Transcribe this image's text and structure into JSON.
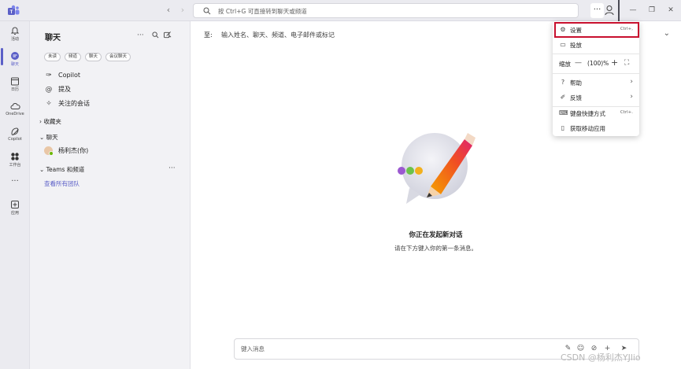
{
  "colors": {
    "accent": "#5b5fc7",
    "highlight": "#c8102e",
    "rail_bg": "#ebebf0",
    "list_bg": "#f2f2f5"
  },
  "search": {
    "placeholder": "按 Ctrl+G 可直接转到聊天或频道"
  },
  "rail": {
    "items": [
      {
        "label": "活动",
        "icon": "bell-icon"
      },
      {
        "label": "聊天",
        "icon": "chat-icon"
      },
      {
        "label": "日历",
        "icon": "calendar-icon"
      },
      {
        "label": "OneDrive",
        "icon": "cloud-icon"
      },
      {
        "label": "Copilot",
        "icon": "copilot-icon"
      },
      {
        "label": "工作台",
        "icon": "apps-grid-icon"
      },
      {
        "label": "",
        "icon": "more-icon"
      },
      {
        "label": "应用",
        "icon": "add-app-icon"
      }
    ]
  },
  "chatlist": {
    "title": "聊天",
    "filters": [
      "未读",
      "频道",
      "聊天",
      "会议聊天"
    ],
    "quick": [
      {
        "label": "Copilot",
        "icon": "copilot-icon"
      },
      {
        "label": "提及",
        "icon": "at-icon"
      },
      {
        "label": "关注的会话",
        "icon": "follow-icon"
      }
    ],
    "favorites": "收藏夹",
    "chats_section": "聊天",
    "chats": [
      {
        "name": "杨利杰(你)"
      }
    ],
    "teams_section": "Teams 和频道",
    "see_all_teams": "查看所有团队"
  },
  "main": {
    "to_label": "至:",
    "to_placeholder": "输入姓名、聊天、频道、电子邮件或标记",
    "empty_title": "你正在发起新对话",
    "empty_subtitle": "请在下方键入你的第一条消息。",
    "composer_placeholder": "键入消息"
  },
  "menu": {
    "settings": {
      "label": "设置",
      "shortcut": "Ctrl+,"
    },
    "cast": {
      "label": "投放"
    },
    "zoom": {
      "label": "缩放",
      "value": "(100)%"
    },
    "help": {
      "label": "帮助"
    },
    "feedback": {
      "label": "反馈"
    },
    "shortcuts": {
      "label": "键盘快捷方式",
      "shortcut": "Ctrl+."
    },
    "mobile": {
      "label": "获取移动应用"
    }
  },
  "watermark": "CSDN @杨利杰YJlio"
}
